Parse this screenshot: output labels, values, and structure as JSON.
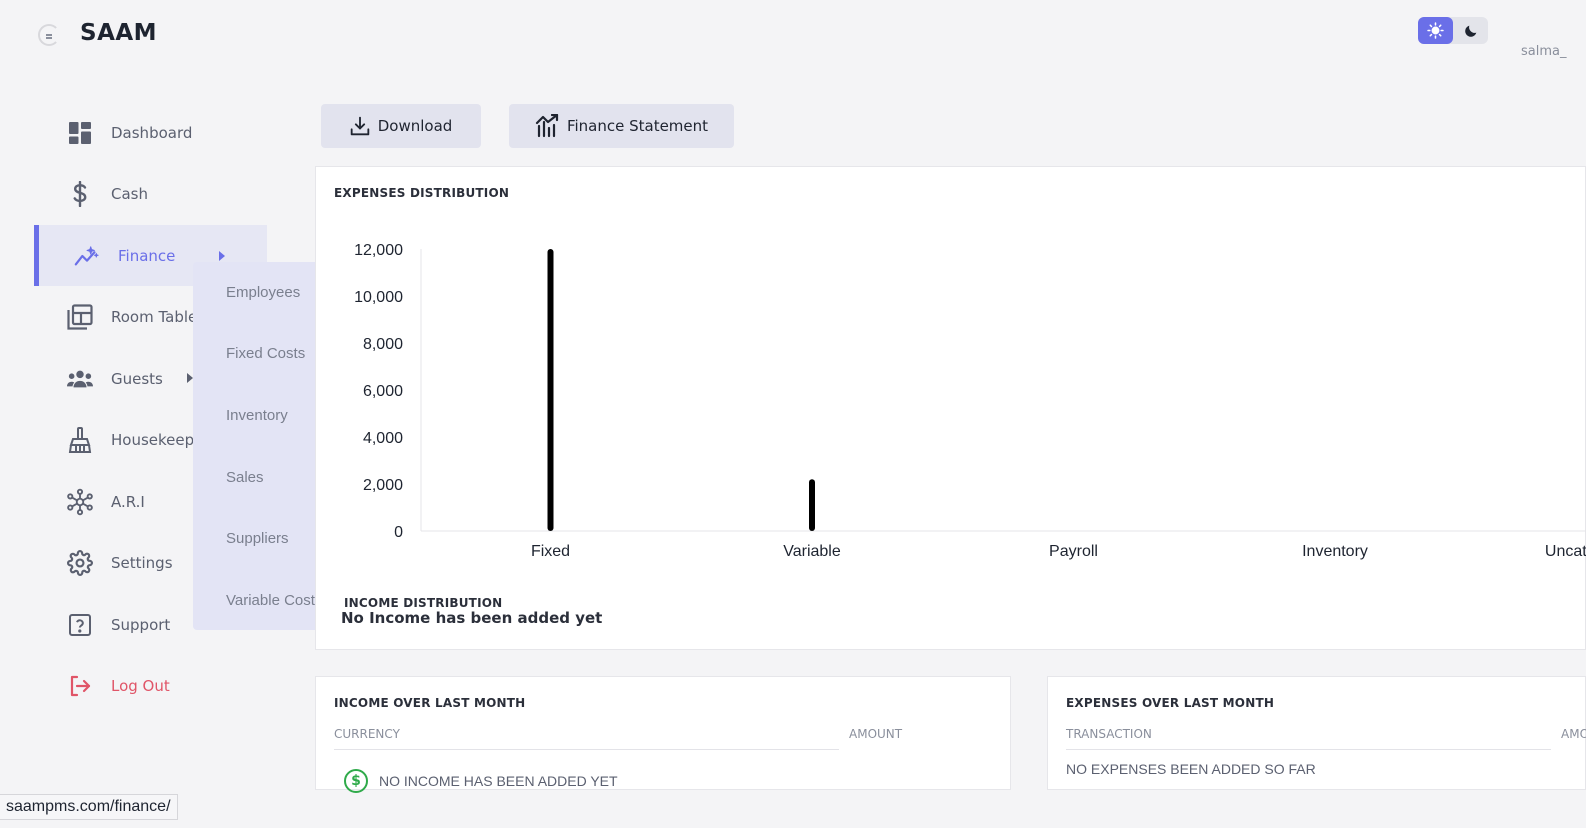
{
  "app": {
    "brand": "SAAM",
    "username": "salma_"
  },
  "sidebar": {
    "items": [
      {
        "label": "Dashboard",
        "icon": "dashboard-icon"
      },
      {
        "label": "Cash",
        "icon": "dollar-icon"
      },
      {
        "label": "Finance",
        "icon": "trend-icon",
        "active": true
      },
      {
        "label": "Room Table",
        "icon": "table-icon"
      },
      {
        "label": "Guests",
        "icon": "users-icon"
      },
      {
        "label": "Housekeeping",
        "icon": "broom-icon"
      },
      {
        "label": "A.R.I",
        "icon": "network-icon"
      },
      {
        "label": "Settings",
        "icon": "gear-icon"
      },
      {
        "label": "Support",
        "icon": "help-icon"
      },
      {
        "label": "Log Out",
        "icon": "logout-icon"
      }
    ],
    "finance_submenu": [
      "Employees",
      "Fixed Costs",
      "Inventory",
      "Sales",
      "Suppliers",
      "Variable Costs"
    ]
  },
  "toolbar": {
    "download_label": "Download",
    "statement_label": "Finance Statement"
  },
  "expenses_card": {
    "title": "EXPENSES DISTRIBUTION",
    "income_title": "INCOME DISTRIBUTION",
    "income_empty": "No Income has been added yet"
  },
  "chart_data": {
    "type": "bar",
    "categories": [
      "Fixed",
      "Variable",
      "Payroll",
      "Inventory",
      "Uncategorized"
    ],
    "values": [
      12000,
      2200,
      0,
      0,
      0
    ],
    "ylim": [
      0,
      12000
    ],
    "yticks": [
      "0",
      "2,000",
      "4,000",
      "6,000",
      "8,000",
      "10,000",
      "12,000"
    ],
    "grid": false
  },
  "income_month": {
    "title": "INCOME OVER LAST MONTH",
    "col_currency": "CURRENCY",
    "col_amount": "AMOUNT",
    "empty": "NO INCOME HAS BEEN ADDED YET"
  },
  "expenses_month": {
    "title": "EXPENSES OVER LAST MONTH",
    "col_transaction": "TRANSACTION",
    "col_amount": "AMOUNT",
    "empty": "NO EXPENSES BEEN ADDED SO FAR"
  },
  "status_bar": {
    "url": "saampms.com/finance/"
  },
  "colors": {
    "accent": "#6a6fe8",
    "danger": "#e05568",
    "bar": "#000000",
    "success": "#2faa4a"
  }
}
